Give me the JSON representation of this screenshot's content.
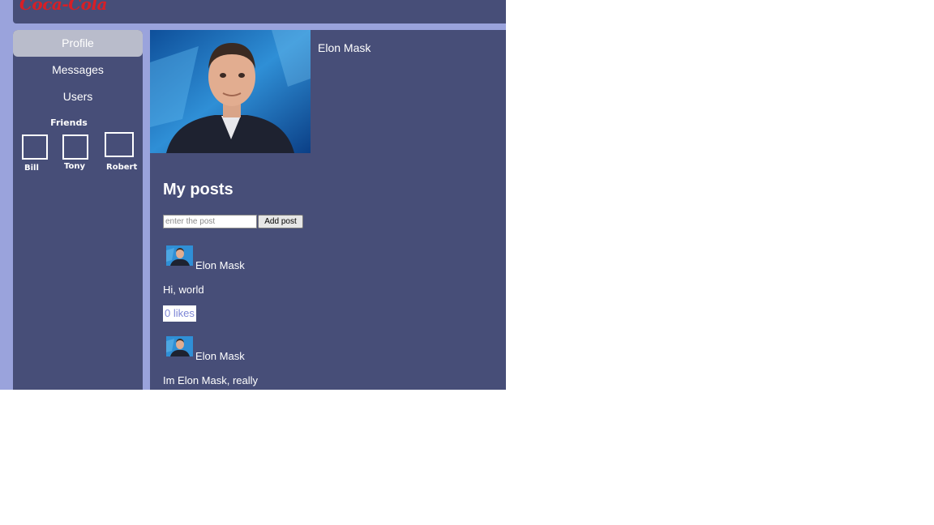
{
  "header": {
    "logo_text": "Coca-Cola"
  },
  "sidebar": {
    "items": [
      {
        "label": "Profile",
        "active": true
      },
      {
        "label": "Messages",
        "active": false
      },
      {
        "label": "Users",
        "active": false
      }
    ],
    "friends": {
      "title": "Friends",
      "list": [
        {
          "name": "Bill"
        },
        {
          "name": "Tony"
        },
        {
          "name": "Robert"
        }
      ]
    }
  },
  "profile": {
    "name": "Elon Mask"
  },
  "posts": {
    "title": "My posts",
    "input_placeholder": "enter the post",
    "add_button_label": "Add post",
    "items": [
      {
        "author": "Elon Mask",
        "text": "Hi, world",
        "likes": "0 likes"
      },
      {
        "author": "Elon Mask",
        "text": "Im Elon Mask, really"
      }
    ]
  },
  "colors": {
    "app_background": "#9aa3dc",
    "panel": "#474e78",
    "active_nav": "#b9bccb",
    "logo": "#d71f26",
    "likes_text": "#7d86d6"
  }
}
